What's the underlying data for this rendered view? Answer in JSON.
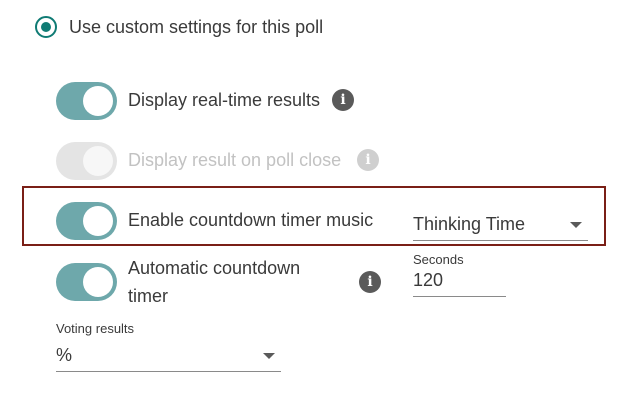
{
  "poll_settings": {
    "custom_option": {
      "label": "Use custom settings for this poll",
      "selected": true
    },
    "display_realtime": {
      "label": "Display real-time results",
      "enabled": true,
      "info_icon": "info-icon"
    },
    "display_on_close": {
      "label": "Display result on poll close",
      "enabled": false,
      "disabled": true,
      "info_icon": "info-icon"
    },
    "countdown_music": {
      "label": "Enable countdown timer music",
      "enabled": true,
      "track_value": "Thinking Time"
    },
    "auto_countdown": {
      "label_line1": "Automatic countdown",
      "label_line2": "timer",
      "enabled": true,
      "info_icon": "info-icon",
      "seconds_label": "Seconds",
      "seconds_value": "120"
    },
    "voting_results": {
      "label": "Voting results",
      "value": "%"
    }
  },
  "colors": {
    "accent": "#0f7b74",
    "toggle_on": "#6ea8ab",
    "toggle_disabled": "#e4e4e4",
    "highlight_border": "#7a1f16"
  }
}
